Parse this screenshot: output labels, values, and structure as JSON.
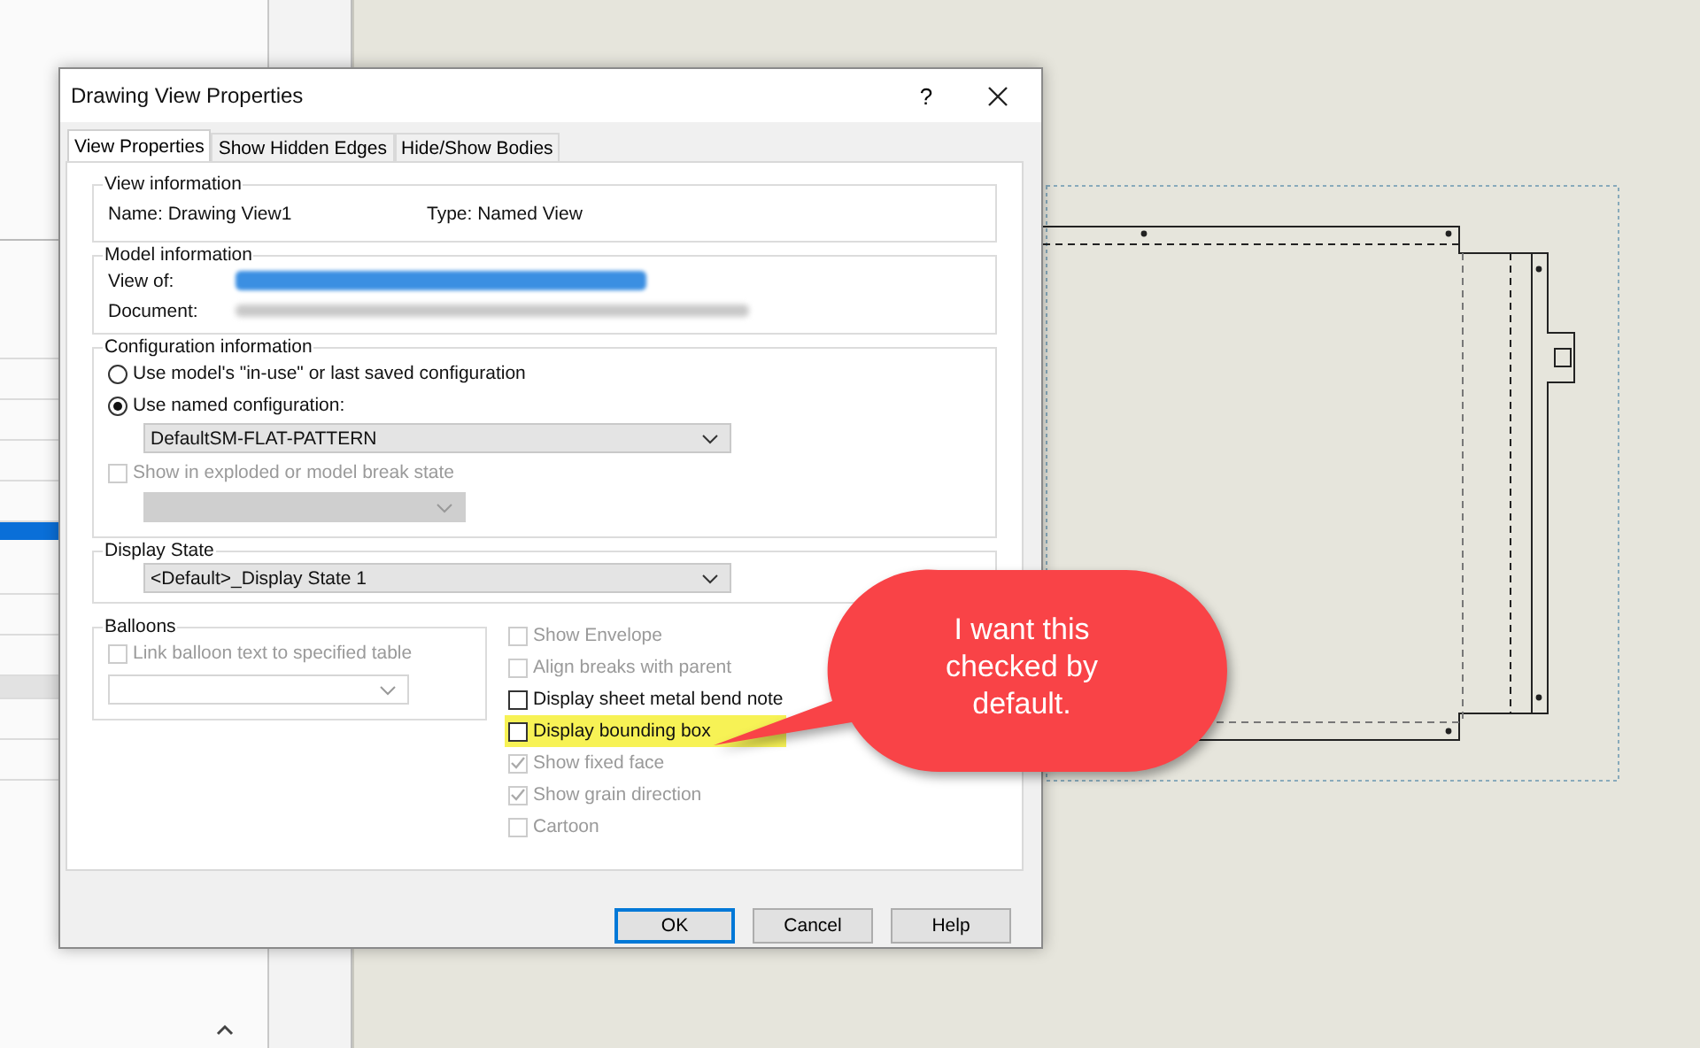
{
  "dialog": {
    "title": "Drawing View Properties",
    "help": "?",
    "tabs": [
      {
        "label": "View Properties",
        "selected": true
      },
      {
        "label": "Show Hidden Edges",
        "selected": false
      },
      {
        "label": "Hide/Show Bodies",
        "selected": false
      }
    ],
    "view_information": {
      "title": "View information",
      "name": "Name: Drawing View1",
      "type": "Type: Named View"
    },
    "model_information": {
      "title": "Model information",
      "view_of_label": "View of:",
      "document_label": "Document:"
    },
    "configuration": {
      "title": "Configuration information",
      "options": [
        {
          "label": "Use model's \"in-use\" or last saved configuration",
          "selected": false
        },
        {
          "label": "Use named configuration:",
          "selected": true
        }
      ],
      "named_configuration": "DefaultSM-FLAT-PATTERN",
      "exploded": {
        "label": "Show in exploded or model break state",
        "checked": false,
        "disabled": true
      }
    },
    "display_state": {
      "title": "Display State",
      "value": "<Default>_Display State 1"
    },
    "balloons": {
      "title": "Balloons",
      "link": {
        "label": "Link balloon text to specified table",
        "checked": false,
        "disabled": true
      }
    },
    "options": [
      {
        "label": "Show Envelope",
        "checked": false,
        "disabled": true,
        "highlighted": false
      },
      {
        "label": "Align breaks with parent",
        "checked": false,
        "disabled": true,
        "highlighted": false
      },
      {
        "label": "Display sheet metal bend note",
        "checked": false,
        "disabled": false,
        "highlighted": false
      },
      {
        "label": "Display bounding box",
        "checked": false,
        "disabled": false,
        "highlighted": true
      },
      {
        "label": "Show fixed face",
        "checked": true,
        "disabled": true,
        "highlighted": false
      },
      {
        "label": "Show grain direction",
        "checked": true,
        "disabled": true,
        "highlighted": false
      },
      {
        "label": "Cartoon",
        "checked": false,
        "disabled": true,
        "highlighted": false
      }
    ],
    "buttons": [
      {
        "label": "OK",
        "default": true
      },
      {
        "label": "Cancel",
        "default": false
      },
      {
        "label": "Help",
        "default": false
      }
    ]
  },
  "callout": {
    "text": "I want this checked by default."
  }
}
